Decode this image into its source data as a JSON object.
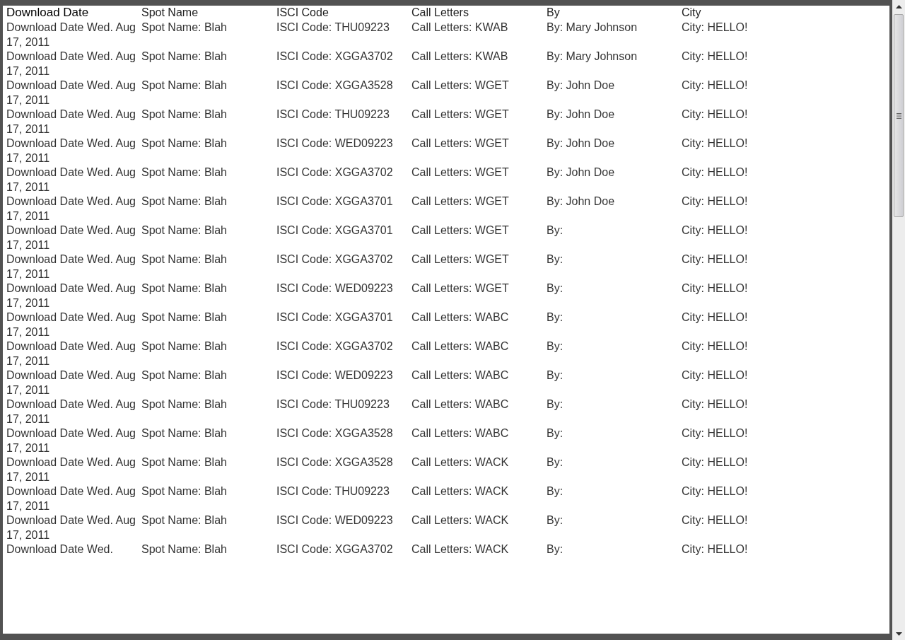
{
  "table": {
    "columns": [
      "Download Date",
      "Spot Name",
      "ISCI Code",
      "Call Letters",
      "By",
      "City"
    ],
    "rows": [
      {
        "download_date": "Download Date Wed. Aug 17, 2011",
        "spot_name": "Spot Name: Blah",
        "isci_code": "ISCI Code: THU09223",
        "call_letters": "Call Letters: KWAB",
        "by": "By: Mary Johnson",
        "city": "City: HELLO!"
      },
      {
        "download_date": "Download Date Wed. Aug 17, 2011",
        "spot_name": "Spot Name: Blah",
        "isci_code": "ISCI Code: XGGA3702",
        "call_letters": "Call Letters: KWAB",
        "by": "By: Mary Johnson",
        "city": "City: HELLO!"
      },
      {
        "download_date": "Download Date Wed. Aug 17, 2011",
        "spot_name": "Spot Name: Blah",
        "isci_code": "ISCI Code: XGGA3528",
        "call_letters": "Call Letters: WGET",
        "by": "By: John Doe",
        "city": "City: HELLO!"
      },
      {
        "download_date": "Download Date Wed. Aug 17, 2011",
        "spot_name": "Spot Name: Blah",
        "isci_code": "ISCI Code: THU09223",
        "call_letters": "Call Letters: WGET",
        "by": "By: John Doe",
        "city": "City: HELLO!"
      },
      {
        "download_date": "Download Date Wed. Aug 17, 2011",
        "spot_name": "Spot Name: Blah",
        "isci_code": "ISCI Code: WED09223",
        "call_letters": "Call Letters: WGET",
        "by": "By: John Doe",
        "city": "City: HELLO!"
      },
      {
        "download_date": "Download Date Wed. Aug 17, 2011",
        "spot_name": "Spot Name: Blah",
        "isci_code": "ISCI Code: XGGA3702",
        "call_letters": "Call Letters: WGET",
        "by": "By: John Doe",
        "city": "City: HELLO!"
      },
      {
        "download_date": "Download Date Wed. Aug 17, 2011",
        "spot_name": "Spot Name: Blah",
        "isci_code": "ISCI Code: XGGA3701",
        "call_letters": "Call Letters: WGET",
        "by": "By: John Doe",
        "city": "City: HELLO!"
      },
      {
        "download_date": "Download Date Wed. Aug 17, 2011",
        "spot_name": "Spot Name: Blah",
        "isci_code": "ISCI Code: XGGA3701",
        "call_letters": "Call Letters: WGET",
        "by": "By:",
        "city": "City: HELLO!"
      },
      {
        "download_date": "Download Date Wed. Aug 17, 2011",
        "spot_name": "Spot Name: Blah",
        "isci_code": "ISCI Code: XGGA3702",
        "call_letters": "Call Letters: WGET",
        "by": "By:",
        "city": "City: HELLO!"
      },
      {
        "download_date": "Download Date Wed. Aug 17, 2011",
        "spot_name": "Spot Name: Blah",
        "isci_code": "ISCI Code: WED09223",
        "call_letters": "Call Letters: WGET",
        "by": "By:",
        "city": "City: HELLO!"
      },
      {
        "download_date": "Download Date Wed. Aug 17, 2011",
        "spot_name": "Spot Name: Blah",
        "isci_code": "ISCI Code: XGGA3701",
        "call_letters": "Call Letters: WABC",
        "by": "By:",
        "city": "City: HELLO!"
      },
      {
        "download_date": "Download Date Wed. Aug 17, 2011",
        "spot_name": "Spot Name: Blah",
        "isci_code": "ISCI Code: XGGA3702",
        "call_letters": "Call Letters: WABC",
        "by": "By:",
        "city": "City: HELLO!"
      },
      {
        "download_date": "Download Date Wed. Aug 17, 2011",
        "spot_name": "Spot Name: Blah",
        "isci_code": "ISCI Code: WED09223",
        "call_letters": "Call Letters: WABC",
        "by": "By:",
        "city": "City: HELLO!"
      },
      {
        "download_date": "Download Date Wed. Aug 17, 2011",
        "spot_name": "Spot Name: Blah",
        "isci_code": "ISCI Code: THU09223",
        "call_letters": "Call Letters: WABC",
        "by": "By:",
        "city": "City: HELLO!"
      },
      {
        "download_date": "Download Date Wed. Aug 17, 2011",
        "spot_name": "Spot Name: Blah",
        "isci_code": "ISCI Code: XGGA3528",
        "call_letters": "Call Letters: WABC",
        "by": "By:",
        "city": "City: HELLO!"
      },
      {
        "download_date": "Download Date Wed. Aug 17, 2011",
        "spot_name": "Spot Name: Blah",
        "isci_code": "ISCI Code: XGGA3528",
        "call_letters": "Call Letters: WACK",
        "by": "By:",
        "city": "City: HELLO!"
      },
      {
        "download_date": "Download Date Wed. Aug 17, 2011",
        "spot_name": "Spot Name: Blah",
        "isci_code": "ISCI Code: THU09223",
        "call_letters": "Call Letters: WACK",
        "by": "By:",
        "city": "City: HELLO!"
      },
      {
        "download_date": "Download Date Wed. Aug 17, 2011",
        "spot_name": "Spot Name: Blah",
        "isci_code": "ISCI Code: WED09223",
        "call_letters": "Call Letters: WACK",
        "by": "By:",
        "city": "City: HELLO!"
      },
      {
        "download_date": "Download Date Wed.",
        "spot_name": "Spot Name: Blah",
        "isci_code": "ISCI Code: XGGA3702",
        "call_letters": "Call Letters: WACK",
        "by": "By:",
        "city": "City: HELLO!"
      }
    ]
  }
}
